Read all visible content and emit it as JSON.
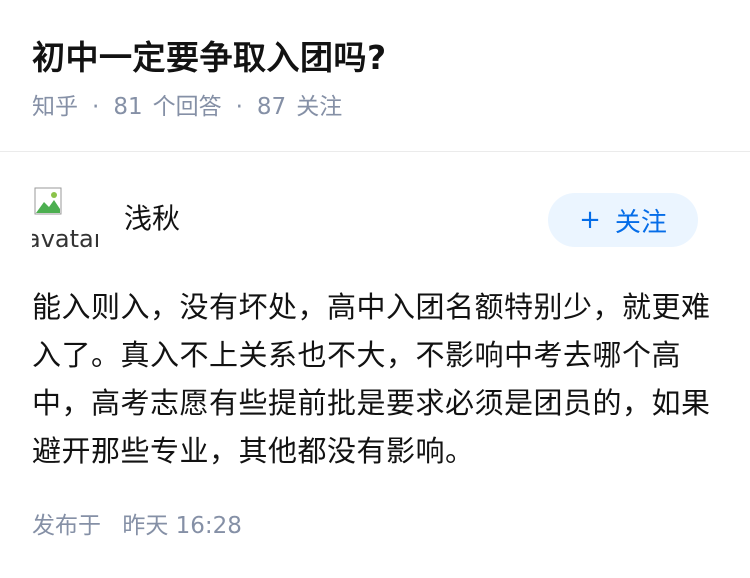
{
  "question": {
    "title": "初中一定要争取入团吗?",
    "source": "知乎",
    "answer_count": "81",
    "answer_label": "个回答",
    "follower_count": "87",
    "follower_label": "关注"
  },
  "author": {
    "name": "浅秋",
    "avatar_alt": "avatar",
    "follow_button": {
      "icon": "+",
      "label": "关注"
    }
  },
  "answer": {
    "content": "能入则入，没有坏处，高中入团名额特别少，就更难入了。真入不上关系也不大，不影响中考去哪个高中，高考志愿有些提前批是要求必须是团员的，如果避开那些专业，其他都没有影响。",
    "published_label": "发布于",
    "published_time": "昨天 16:28"
  },
  "colors": {
    "meta_gray": "#8590a6",
    "follow_bg": "#ebf5ff",
    "follow_text": "#056de8",
    "divider": "#ebebeb"
  }
}
